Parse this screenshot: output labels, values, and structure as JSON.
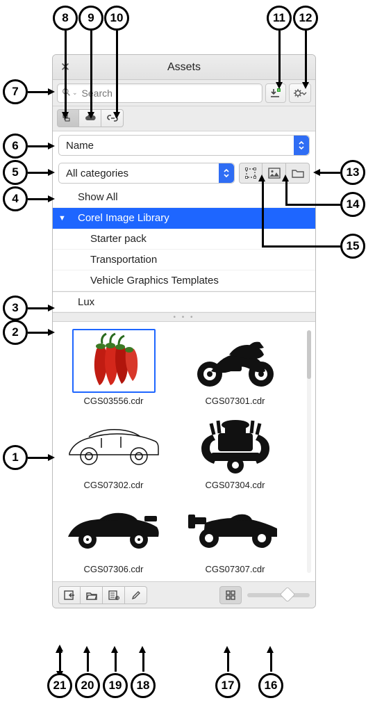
{
  "panel": {
    "title": "Assets",
    "search_placeholder": "Search",
    "sort_label": "Name",
    "category_label": "All categories",
    "tree": [
      {
        "label": "Show All",
        "depth": 0
      },
      {
        "label": "Corel Image Library",
        "depth": 0,
        "selected": true,
        "expanded": true
      },
      {
        "label": "Starter pack",
        "depth": 1
      },
      {
        "label": "Transportation",
        "depth": 1
      },
      {
        "label": "Vehicle Graphics Templates",
        "depth": 1
      },
      {
        "label": "Lux",
        "depth": 0
      }
    ],
    "thumbs": [
      {
        "name": "CGS03556.cdr",
        "selected": true
      },
      {
        "name": "CGS07301.cdr"
      },
      {
        "name": "CGS07302.cdr"
      },
      {
        "name": "CGS07304.cdr"
      },
      {
        "name": "CGS07306.cdr"
      },
      {
        "name": "CGS07307.cdr"
      }
    ]
  },
  "callouts": [
    "1",
    "2",
    "3",
    "4",
    "5",
    "6",
    "7",
    "8",
    "9",
    "10",
    "11",
    "12",
    "13",
    "14",
    "15",
    "16",
    "17",
    "18",
    "19",
    "20",
    "21"
  ]
}
